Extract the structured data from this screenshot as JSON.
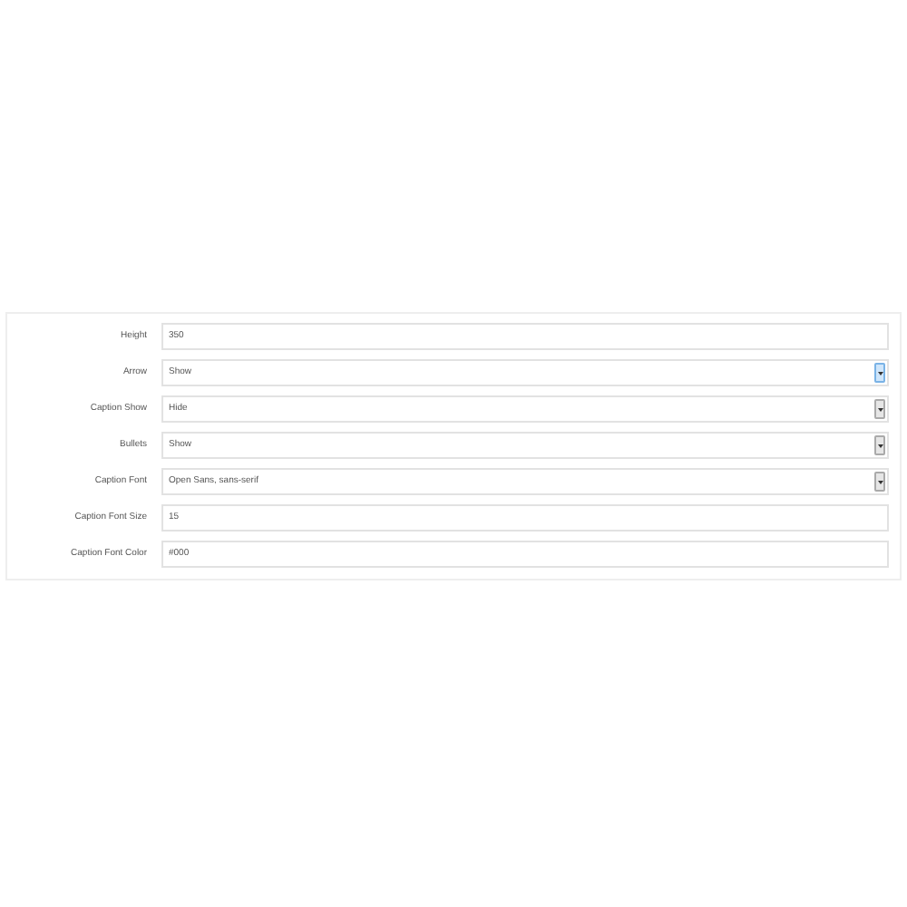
{
  "fields": [
    {
      "label": "Height",
      "kind": "text",
      "value": "350"
    },
    {
      "label": "Arrow",
      "kind": "select",
      "value": "Show",
      "focused": true
    },
    {
      "label": "Caption Show",
      "kind": "select",
      "value": "Hide",
      "focused": false
    },
    {
      "label": "Bullets",
      "kind": "select",
      "value": "Show",
      "focused": false
    },
    {
      "label": "Caption Font",
      "kind": "select",
      "value": "Open Sans, sans-serif",
      "focused": false
    },
    {
      "label": "Caption Font Size",
      "kind": "text",
      "value": "15"
    },
    {
      "label": "Caption Font Color",
      "kind": "text",
      "value": "#000"
    }
  ]
}
